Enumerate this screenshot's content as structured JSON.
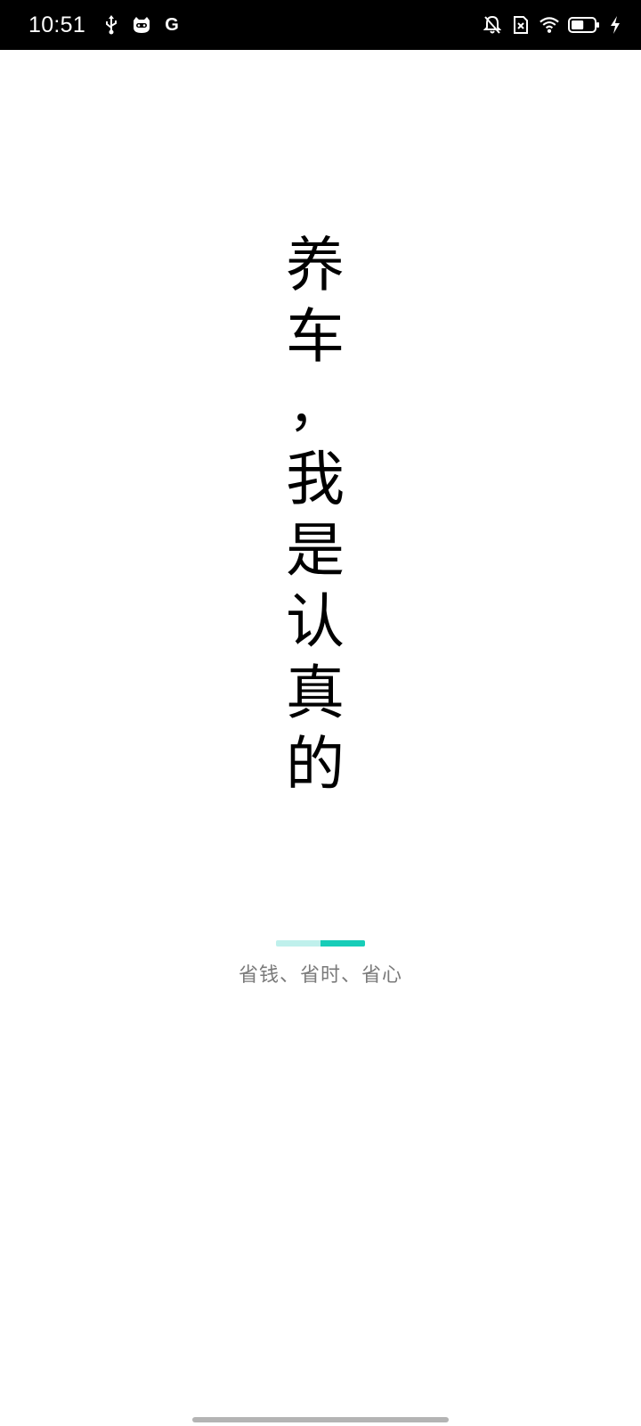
{
  "status_bar": {
    "time": "10:51",
    "left_icons": [
      "usb-icon",
      "cat-face-icon",
      "google-g-icon"
    ],
    "google_letter": "G",
    "right_icons": [
      "notifications-off-icon",
      "no-sim-icon",
      "wifi-icon",
      "battery-icon",
      "charging-icon"
    ],
    "battery_level": 0.55
  },
  "slogan": {
    "chars": [
      "养",
      "车",
      "，",
      "我",
      "是",
      "认",
      "真",
      "的"
    ]
  },
  "progress": {
    "fraction_filled": 0.5,
    "track_color": "#bff0ec",
    "fill_color": "#17cdb8"
  },
  "tagline": "省钱、省时、省心",
  "colors": {
    "status_bar_bg": "#000000",
    "tagline": "#7a7a7a"
  }
}
